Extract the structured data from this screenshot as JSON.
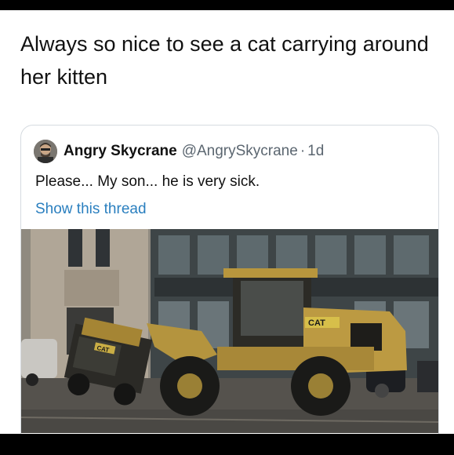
{
  "post": {
    "caption": "Always so nice to see a cat carrying around her kitten"
  },
  "quoted_tweet": {
    "display_name": "Angry Skycrane",
    "handle": "@AngrySkycrane",
    "separator": "·",
    "timestamp": "1d",
    "text": "Please... My son... he is very sick.",
    "thread_link": "Show this thread",
    "avatar_icon": "user-avatar-icon",
    "image": {
      "subject": "large loader carrying small loader",
      "big_loader_badge": "CAT",
      "small_loader_badge": "CAT"
    }
  },
  "colors": {
    "link": "#2a7fbf",
    "loader_yellow": "#b9973e",
    "frame_black": "#000000"
  }
}
